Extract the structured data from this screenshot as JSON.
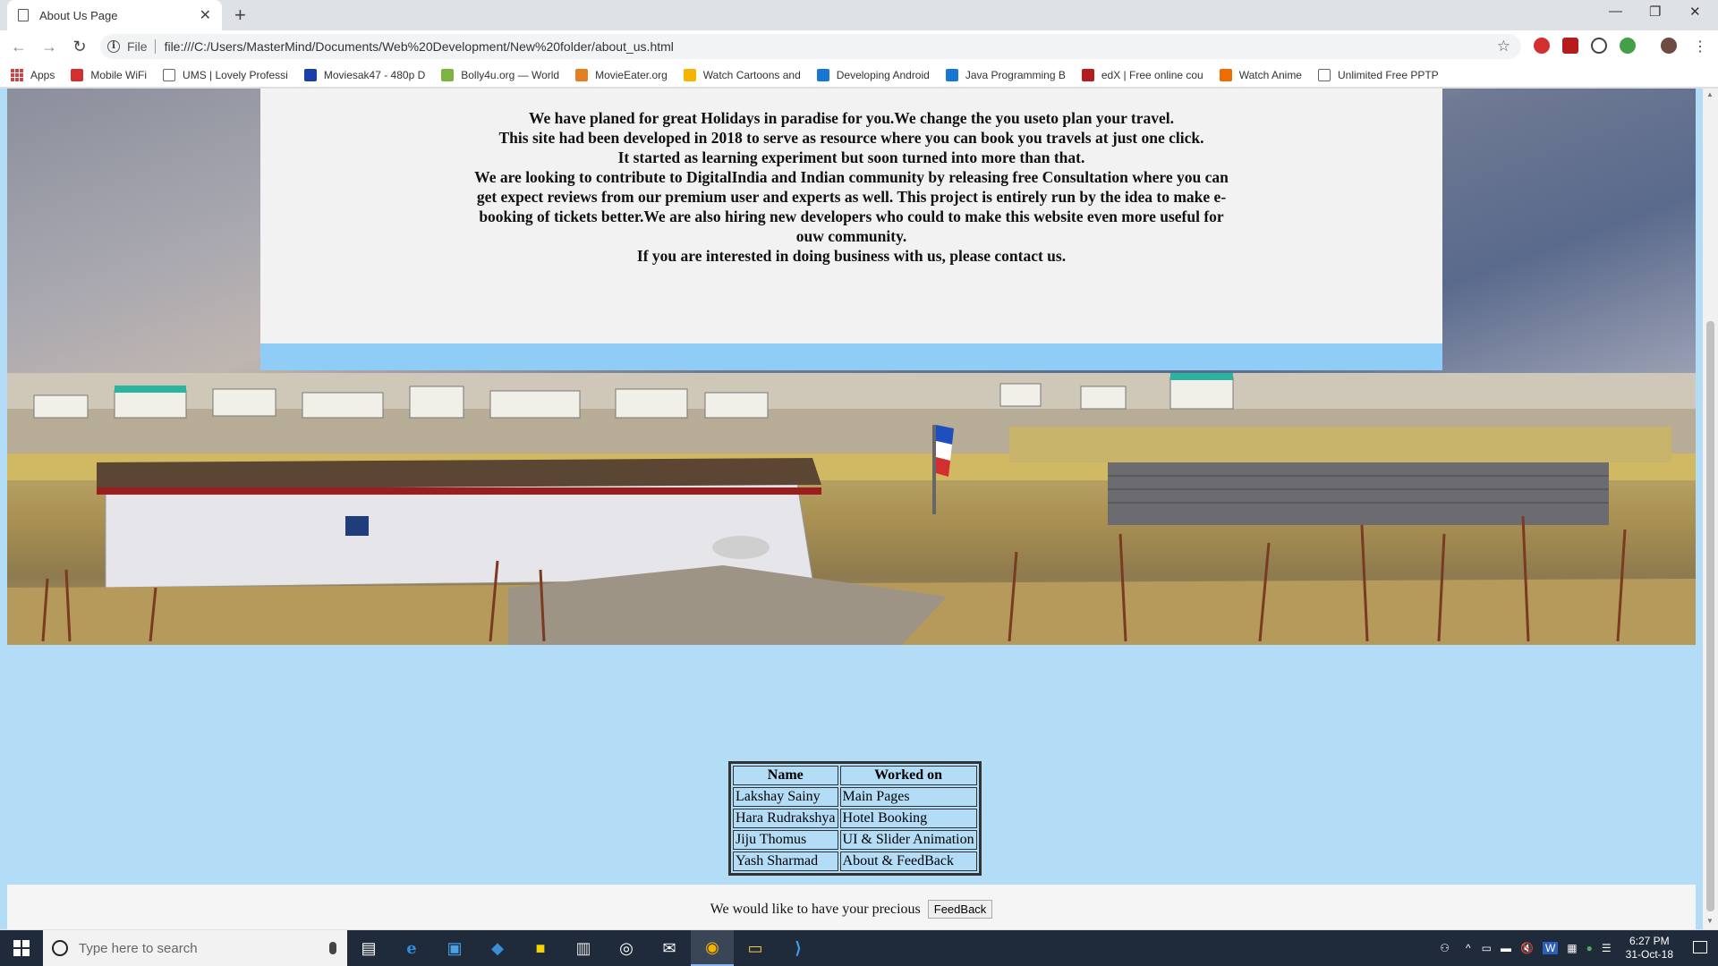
{
  "browser": {
    "tab_title": "About Us Page",
    "new_tab": "+",
    "address_scheme": "File",
    "address_url": "file:///C:/Users/MasterMind/Documents/Web%20Development/New%20folder/about_us.html"
  },
  "bookmarks": [
    {
      "label": "Apps"
    },
    {
      "label": "Mobile WiFi",
      "color": "#d32f2f"
    },
    {
      "label": "UMS | Lovely Professi",
      "color": "#ffffff"
    },
    {
      "label": "Moviesak47 - 480p D",
      "color": "#1a3fa8"
    },
    {
      "label": "Bolly4u.org — World",
      "color": "#7cb342"
    },
    {
      "label": "MovieEater.org",
      "color": "#e67e22"
    },
    {
      "label": "Watch Cartoons and",
      "color": "#f4b400"
    },
    {
      "label": "Developing Android",
      "color": "#1976d2"
    },
    {
      "label": "Java Programming B",
      "color": "#1976d2"
    },
    {
      "label": "edX | Free online cou",
      "color": "#b71c1c"
    },
    {
      "label": "Watch Anime",
      "color": "#ef6c00"
    },
    {
      "label": "Unlimited Free PPTP",
      "color": "#ffffff"
    }
  ],
  "about": {
    "lines": [
      "We have planed for great Holidays in paradise for you.We change the you useto plan your travel.",
      "This site had been developed in 2018 to serve as resource where you can book you travels at just one click.",
      "It started as learning experiment but soon turned into more than that.",
      "We are looking to contribute to DigitalIndia and Indian community by releasing free Consultation where you can get expect reviews from our premium user and experts as well. This project is entirely run by the idea to make e-booking of tickets better.We are also hiring new developers who could to make this website even more useful for ouw community.",
      "If you are interested in doing business with us, please contact us."
    ]
  },
  "team_table": {
    "headers": [
      "Name",
      "Worked on"
    ],
    "rows": [
      [
        "Lakshay Sainy",
        "Main Pages"
      ],
      [
        "Hara Rudrakshya",
        "Hotel Booking"
      ],
      [
        "Jiju Thomus",
        "UI & Slider Animation"
      ],
      [
        "Yash Sharmad",
        "About & FeedBack"
      ]
    ]
  },
  "footer": {
    "text": "We would like to have your precious",
    "button_label": "FeedBack"
  },
  "taskbar": {
    "search_placeholder": "Type here to search",
    "time": "6:27 PM",
    "date": "31-Oct-18"
  },
  "colors": {
    "page_background": "#b3dcf7",
    "content_box": "#f2f2f2",
    "content_strip": "#8fcdf6",
    "taskbar": "#1f2a3a"
  }
}
